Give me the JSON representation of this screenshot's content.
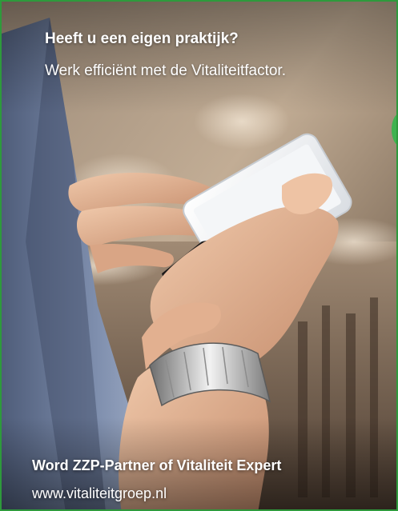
{
  "ad": {
    "headline": "Heeft u een eigen praktijk?",
    "subline": "Werk efficiënt met de Vitaliteitfactor.",
    "cta": "Word ZZP-Partner of  Vitaliteit Expert",
    "website": "www.vitaliteitgroep.nl"
  },
  "colors": {
    "border": "#2e9a3c",
    "text": "#ffffff"
  }
}
